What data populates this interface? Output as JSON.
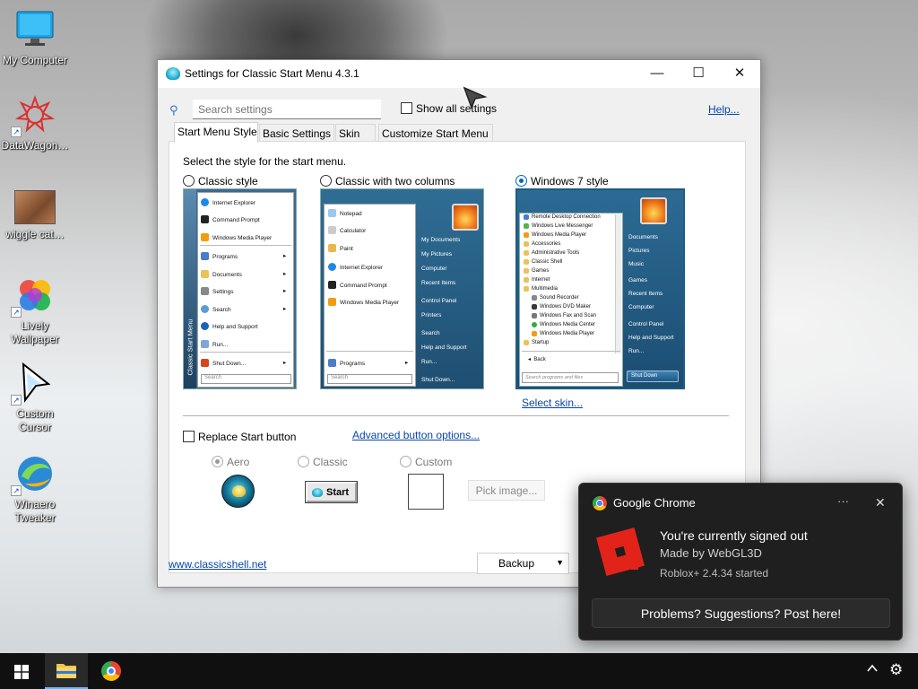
{
  "desktop": {
    "icons": [
      {
        "label": "My Computer",
        "icon": "computer-icon"
      },
      {
        "label": "DataWagon…",
        "icon": "datawagon-icon"
      },
      {
        "label": "wiggle cat…",
        "icon": "photo-icon"
      },
      {
        "label": "Lively\nWallpaper",
        "icon": "lively-wallpaper-icon"
      },
      {
        "label": "Custom\nCursor",
        "icon": "cursor-icon"
      },
      {
        "label": "Winaero\nTweaker",
        "icon": "winaero-icon"
      }
    ]
  },
  "window": {
    "title": "Settings for Classic Start Menu 4.3.1",
    "controls": {
      "minimize": "—",
      "maximize": "☐",
      "close": "✕"
    },
    "search": {
      "placeholder": "Search settings"
    },
    "show_all_label": "Show all settings",
    "help_label": "Help...",
    "tabs": [
      "Start Menu Style",
      "Basic Settings",
      "Skin",
      "Customize Start Menu"
    ],
    "prompt": "Select the style for the start menu.",
    "styles": [
      {
        "label": "Classic style",
        "selected": false
      },
      {
        "label": "Classic with two columns",
        "selected": false
      },
      {
        "label": "Windows 7 style",
        "selected": true
      }
    ],
    "classic_preview": {
      "items": [
        "Internet Explorer",
        "Command Prompt",
        "Windows Media Player",
        "Programs",
        "Documents",
        "Settings",
        "Search",
        "Help and Support",
        "Run...",
        "Shut Down..."
      ],
      "side_label": "Classic Start Menu",
      "search": "Search"
    },
    "two_col_preview": {
      "left": [
        "Notepad",
        "Calculator",
        "Paint",
        "Internet Explorer",
        "Command Prompt",
        "Windows Media Player"
      ],
      "programs": "Programs",
      "search": "Search",
      "right": [
        "My Documents",
        "My Pictures",
        "Computer",
        "Recent Items",
        "Control Panel",
        "Printers",
        "Search",
        "Help and Support",
        "Run...",
        "Shut Down..."
      ]
    },
    "win7_preview": {
      "left": [
        "Remote Desktop Connection",
        "Windows Live Messenger",
        "Windows Media Player",
        "Accessories",
        "Administrative Tools",
        "Classic Shell",
        "Games",
        "Internet",
        "Multimedia",
        "Sound Recorder",
        "Windows DVD Maker",
        "Windows Fax and Scan",
        "Windows Media Center",
        "Windows Media Player",
        "Startup"
      ],
      "back": "Back",
      "search": "Search programs and files",
      "right": [
        "Documents",
        "Pictures",
        "Music",
        "Games",
        "Recent Items",
        "Computer",
        "Control Panel",
        "Help and Support",
        "Run..."
      ],
      "shutdown": "Shut Down"
    },
    "select_skin_label": "Select skin...",
    "replace_start_label": "Replace Start button",
    "advanced_button_label": "Advanced button options...",
    "button_styles": [
      {
        "label": "Aero",
        "selected": true
      },
      {
        "label": "Classic",
        "selected": false
      },
      {
        "label": "Custom",
        "selected": false
      }
    ],
    "classic_button_text": "Start",
    "pick_image_label": "Pick image...",
    "website_label": "www.classicshell.net",
    "backup_label": "Backup"
  },
  "toast": {
    "app": "Google Chrome",
    "title": "You're currently signed out",
    "subtitle": "Made by WebGL3D",
    "detail": "Roblox+ 2.4.34 started",
    "action": "Problems? Suggestions? Post here!",
    "more": "···",
    "close": "✕"
  },
  "taskbar": {
    "items": [
      "start-icon",
      "file-explorer-icon",
      "chrome-icon"
    ],
    "tray": [
      "chevron-up-icon",
      "gear-icon"
    ]
  },
  "colors": {
    "accent": "#0067c0",
    "link": "#0645ad",
    "win7_bg": "#1c5a8a",
    "toast_bg": "#1f1f1f"
  }
}
